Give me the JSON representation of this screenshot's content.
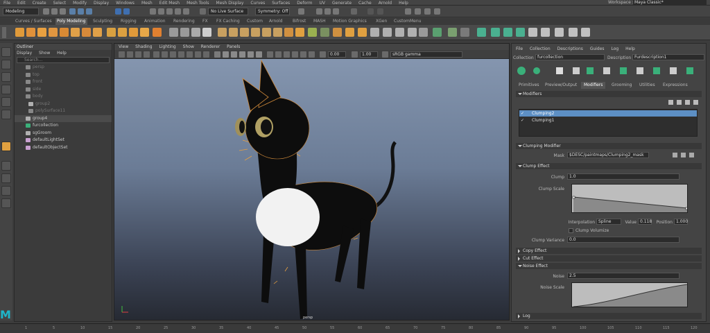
{
  "menubar": {
    "items": [
      "File",
      "Edit",
      "Create",
      "Select",
      "Modify",
      "Display",
      "Windows",
      "Mesh",
      "Edit Mesh",
      "Mesh Tools",
      "Mesh Display",
      "Curves",
      "Surfaces",
      "Deform",
      "UV",
      "Generate",
      "Cache",
      "Arnold",
      "Help"
    ],
    "workspace_label": "Workspace :",
    "workspace_value": "Maya Classic*"
  },
  "status": {
    "mode": "Modeling",
    "live_surface": "No Live Surface",
    "symmetry": "Symmetry: Off"
  },
  "shelf_tabs": [
    "Curves / Surfaces",
    "Poly Modeling",
    "Sculpting",
    "Rigging",
    "Animation",
    "Rendering",
    "FX",
    "FX Caching",
    "Custom",
    "Arnold",
    "Bifrost",
    "MASH",
    "Motion Graphics",
    "XGen",
    "CustomMenu"
  ],
  "shelf_active": "Poly Modeling",
  "outliner": {
    "title": "Outliner",
    "menu": [
      "Display",
      "Show",
      "Help"
    ],
    "search_placeholder": "Search...",
    "items": [
      {
        "label": "persp",
        "dim": true,
        "icon": "camera-icon"
      },
      {
        "label": "top",
        "dim": true,
        "icon": "camera-icon"
      },
      {
        "label": "front",
        "dim": true,
        "icon": "camera-icon"
      },
      {
        "label": "side",
        "dim": true,
        "icon": "camera-icon"
      },
      {
        "label": "body",
        "dim": true,
        "icon": "mesh-icon"
      },
      {
        "label": "group2",
        "dim": true,
        "icon": "group-icon"
      },
      {
        "label": "polySurface11",
        "dim": true,
        "icon": "mesh-icon"
      },
      {
        "label": "group4",
        "dim": false,
        "icon": "group-icon",
        "selected": true
      },
      {
        "label": "furcollection",
        "dim": false,
        "icon": "xgen-collection-icon"
      },
      {
        "label": "sgGroom",
        "dim": false,
        "icon": "group-icon"
      },
      {
        "label": "defaultLightSet",
        "dim": false,
        "icon": "set-icon"
      },
      {
        "label": "defaultObjectSet",
        "dim": false,
        "icon": "set-icon"
      }
    ]
  },
  "viewport": {
    "menu": [
      "View",
      "Shading",
      "Lighting",
      "Show",
      "Renderer",
      "Panels"
    ],
    "field_a": "0.00",
    "field_b": "1.00",
    "colorspace": "sRGB gamma",
    "camera_label": "persp"
  },
  "xgen": {
    "menu": [
      "File",
      "Collection",
      "Descriptions",
      "Guides",
      "Log",
      "Help"
    ],
    "collection_label": "Collection",
    "collection_value": "furcollection",
    "description_label": "Description",
    "description_value": "Furdescription1",
    "tabs": [
      "Primitives",
      "Preview/Output",
      "Modifiers",
      "Grooming",
      "Utilities",
      "Expressions"
    ],
    "active_tab": "Modifiers",
    "modifiers_header": "Modifiers",
    "modifier_list": [
      {
        "label": "Clumping2",
        "selected": true
      },
      {
        "label": "Clumping1",
        "selected": false
      }
    ],
    "clumping_header": "Clumping Modifier",
    "mask_label": "Mask",
    "mask_value": "$DESC/paintmaps/Clumping2_mask",
    "clump_effect_header": "Clump Effect",
    "clump_label": "Clump",
    "clump_value": "1.0",
    "clump_scale_label": "Clump Scale",
    "interp_label": "Interpolation",
    "interp_value": "Spline",
    "value_label": "Value",
    "value_value": "0.118",
    "position_label": "Position",
    "position_value": "1.000",
    "clump_volumize_label": "Clump Volumize",
    "clump_variance_label": "Clump Variance",
    "clump_variance_value": "0.0",
    "copy_effect_header": "Copy Effect",
    "cut_effect_header": "Cut Effect",
    "noise_effect_header": "Noise Effect",
    "noise_label": "Noise",
    "noise_value": "2.5",
    "noise_scale_label": "Noise Scale",
    "log_header": "Log"
  },
  "timeline": {
    "ticks": [
      "1",
      "5",
      "10",
      "15",
      "20",
      "25",
      "30",
      "35",
      "40",
      "45",
      "50",
      "55",
      "60",
      "65",
      "70",
      "75",
      "80",
      "85",
      "90",
      "95",
      "100",
      "105",
      "110",
      "115",
      "120"
    ]
  },
  "logo_text": "M"
}
